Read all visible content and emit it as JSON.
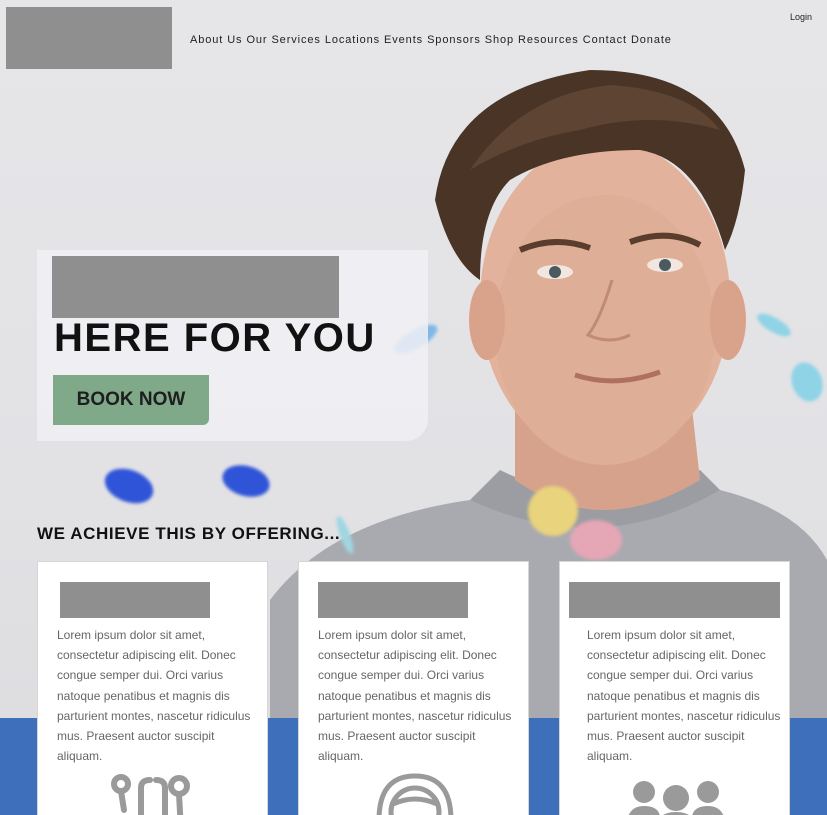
{
  "header": {
    "nav": [
      "About Us",
      "Our Services",
      "Locations",
      "Events",
      "Sponsors",
      "Shop",
      "Resources",
      "Contact",
      "Donate"
    ],
    "login_label": "Login"
  },
  "hero": {
    "title": "HERE FOR YOU",
    "cta_label": "BOOK NOW"
  },
  "offerings": {
    "heading": "WE ACHIEVE THIS BY OFFERING...",
    "cards": [
      {
        "body": "Lorem ipsum dolor sit amet, consectetur adipiscing elit. Donec congue semper dui. Orci varius natoque penatibus et magnis dis parturient montes, nascetur ridiculus mus. Praesent auctor suscipit aliquam.",
        "icon": "stethoscope-icon"
      },
      {
        "body": "Lorem ipsum dolor sit amet, consectetur adipiscing elit. Donec congue semper dui. Orci varius natoque penatibus et magnis dis parturient montes, nascetur ridiculus mus. Praesent auctor suscipit aliquam.",
        "icon": "headset-icon"
      },
      {
        "body": "Lorem ipsum dolor sit amet, consectetur adipiscing elit. Donec congue semper dui. Orci varius natoque penatibus et magnis dis parturient montes, nascetur ridiculus mus. Praesent auctor suscipit aliquam.",
        "icon": "group-icon"
      }
    ]
  },
  "colors": {
    "accent_green": "#7fa989",
    "band_blue": "#3d6fbb",
    "redaction_gray": "#8f8f8f"
  }
}
